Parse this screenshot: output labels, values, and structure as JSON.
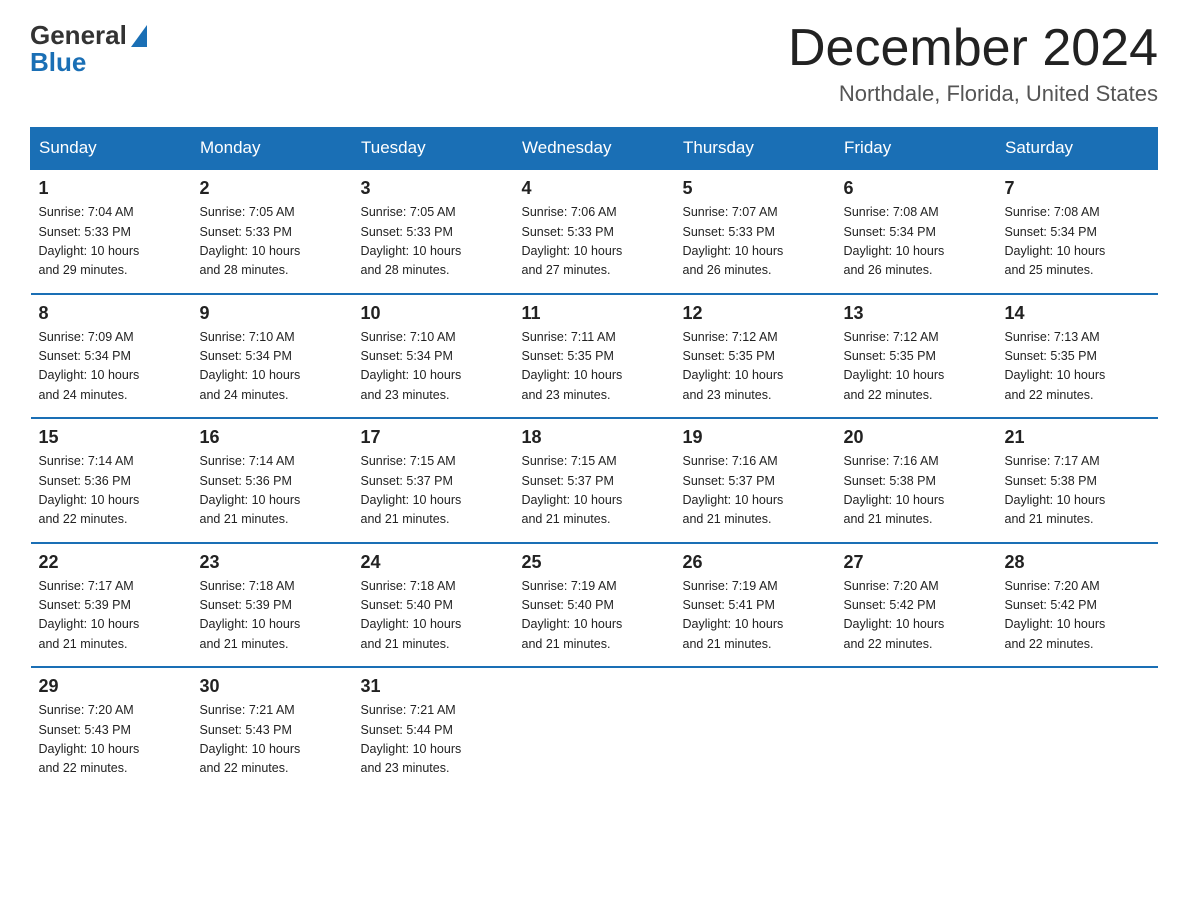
{
  "logo": {
    "general": "General",
    "blue": "Blue"
  },
  "header": {
    "month": "December 2024",
    "location": "Northdale, Florida, United States"
  },
  "weekdays": [
    "Sunday",
    "Monday",
    "Tuesday",
    "Wednesday",
    "Thursday",
    "Friday",
    "Saturday"
  ],
  "weeks": [
    [
      {
        "day": "1",
        "info": "Sunrise: 7:04 AM\nSunset: 5:33 PM\nDaylight: 10 hours\nand 29 minutes."
      },
      {
        "day": "2",
        "info": "Sunrise: 7:05 AM\nSunset: 5:33 PM\nDaylight: 10 hours\nand 28 minutes."
      },
      {
        "day": "3",
        "info": "Sunrise: 7:05 AM\nSunset: 5:33 PM\nDaylight: 10 hours\nand 28 minutes."
      },
      {
        "day": "4",
        "info": "Sunrise: 7:06 AM\nSunset: 5:33 PM\nDaylight: 10 hours\nand 27 minutes."
      },
      {
        "day": "5",
        "info": "Sunrise: 7:07 AM\nSunset: 5:33 PM\nDaylight: 10 hours\nand 26 minutes."
      },
      {
        "day": "6",
        "info": "Sunrise: 7:08 AM\nSunset: 5:34 PM\nDaylight: 10 hours\nand 26 minutes."
      },
      {
        "day": "7",
        "info": "Sunrise: 7:08 AM\nSunset: 5:34 PM\nDaylight: 10 hours\nand 25 minutes."
      }
    ],
    [
      {
        "day": "8",
        "info": "Sunrise: 7:09 AM\nSunset: 5:34 PM\nDaylight: 10 hours\nand 24 minutes."
      },
      {
        "day": "9",
        "info": "Sunrise: 7:10 AM\nSunset: 5:34 PM\nDaylight: 10 hours\nand 24 minutes."
      },
      {
        "day": "10",
        "info": "Sunrise: 7:10 AM\nSunset: 5:34 PM\nDaylight: 10 hours\nand 23 minutes."
      },
      {
        "day": "11",
        "info": "Sunrise: 7:11 AM\nSunset: 5:35 PM\nDaylight: 10 hours\nand 23 minutes."
      },
      {
        "day": "12",
        "info": "Sunrise: 7:12 AM\nSunset: 5:35 PM\nDaylight: 10 hours\nand 23 minutes."
      },
      {
        "day": "13",
        "info": "Sunrise: 7:12 AM\nSunset: 5:35 PM\nDaylight: 10 hours\nand 22 minutes."
      },
      {
        "day": "14",
        "info": "Sunrise: 7:13 AM\nSunset: 5:35 PM\nDaylight: 10 hours\nand 22 minutes."
      }
    ],
    [
      {
        "day": "15",
        "info": "Sunrise: 7:14 AM\nSunset: 5:36 PM\nDaylight: 10 hours\nand 22 minutes."
      },
      {
        "day": "16",
        "info": "Sunrise: 7:14 AM\nSunset: 5:36 PM\nDaylight: 10 hours\nand 21 minutes."
      },
      {
        "day": "17",
        "info": "Sunrise: 7:15 AM\nSunset: 5:37 PM\nDaylight: 10 hours\nand 21 minutes."
      },
      {
        "day": "18",
        "info": "Sunrise: 7:15 AM\nSunset: 5:37 PM\nDaylight: 10 hours\nand 21 minutes."
      },
      {
        "day": "19",
        "info": "Sunrise: 7:16 AM\nSunset: 5:37 PM\nDaylight: 10 hours\nand 21 minutes."
      },
      {
        "day": "20",
        "info": "Sunrise: 7:16 AM\nSunset: 5:38 PM\nDaylight: 10 hours\nand 21 minutes."
      },
      {
        "day": "21",
        "info": "Sunrise: 7:17 AM\nSunset: 5:38 PM\nDaylight: 10 hours\nand 21 minutes."
      }
    ],
    [
      {
        "day": "22",
        "info": "Sunrise: 7:17 AM\nSunset: 5:39 PM\nDaylight: 10 hours\nand 21 minutes."
      },
      {
        "day": "23",
        "info": "Sunrise: 7:18 AM\nSunset: 5:39 PM\nDaylight: 10 hours\nand 21 minutes."
      },
      {
        "day": "24",
        "info": "Sunrise: 7:18 AM\nSunset: 5:40 PM\nDaylight: 10 hours\nand 21 minutes."
      },
      {
        "day": "25",
        "info": "Sunrise: 7:19 AM\nSunset: 5:40 PM\nDaylight: 10 hours\nand 21 minutes."
      },
      {
        "day": "26",
        "info": "Sunrise: 7:19 AM\nSunset: 5:41 PM\nDaylight: 10 hours\nand 21 minutes."
      },
      {
        "day": "27",
        "info": "Sunrise: 7:20 AM\nSunset: 5:42 PM\nDaylight: 10 hours\nand 22 minutes."
      },
      {
        "day": "28",
        "info": "Sunrise: 7:20 AM\nSunset: 5:42 PM\nDaylight: 10 hours\nand 22 minutes."
      }
    ],
    [
      {
        "day": "29",
        "info": "Sunrise: 7:20 AM\nSunset: 5:43 PM\nDaylight: 10 hours\nand 22 minutes."
      },
      {
        "day": "30",
        "info": "Sunrise: 7:21 AM\nSunset: 5:43 PM\nDaylight: 10 hours\nand 22 minutes."
      },
      {
        "day": "31",
        "info": "Sunrise: 7:21 AM\nSunset: 5:44 PM\nDaylight: 10 hours\nand 23 minutes."
      },
      null,
      null,
      null,
      null
    ]
  ]
}
